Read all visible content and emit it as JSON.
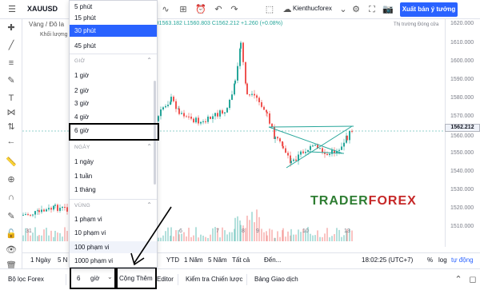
{
  "topbar": {
    "symbol": "XAUUSD",
    "layout_name": "Kienthucforex",
    "publish_label": "Xuất bản ý tưởng"
  },
  "chart": {
    "subtitle": "Vàng / Đô la",
    "volume_label": "Khối lượng",
    "ohlc": "852  H1563.182  L1560.803  C1562.212  +1.260 (+0.08%)",
    "market_closed": "Thị trường Đóng cửa",
    "last_price": "1562.212",
    "price_labels": [
      "1620.000",
      "1610.000",
      "1600.000",
      "1590.000",
      "1580.000",
      "1570.000",
      "1560.000",
      "1550.000",
      "1540.000",
      "1530.000",
      "1520.000",
      "1510.000"
    ],
    "time_labels": [
      "31",
      "6",
      "7",
      "8",
      "9",
      "10",
      "13"
    ],
    "watermark_a": "TRADER",
    "watermark_b": "FOREX"
  },
  "rangebar": {
    "items": [
      "1 Ngày",
      "5 N",
      "YTD",
      "1 Năm",
      "5 Năm",
      "Tất cả",
      "Đến..."
    ],
    "clock": "18:02:25 (UTC+7)",
    "pct": "%",
    "log": "log",
    "auto": "tự động"
  },
  "bottombar": {
    "screener": "Bộ lọc Forex",
    "qty": "6",
    "unit": "giờ",
    "add_label": "Cộng Thêm",
    "editor": "Editor",
    "strategy": "Kiểm tra Chiến lược",
    "trading": "Bảng Giao dịch"
  },
  "dropdown": {
    "items_top": [
      "5 phút",
      "15 phút",
      "30 phút",
      "45 phút"
    ],
    "selected": "30 phút",
    "group_hour": "GIỜ",
    "items_hour": [
      "1 giờ",
      "2 giờ",
      "3 giờ",
      "4 giờ",
      "6 giờ"
    ],
    "group_day": "NGÀY",
    "items_day": [
      "1 ngày",
      "1 tuần",
      "1 tháng"
    ],
    "group_range": "VÙNG",
    "items_range": [
      "1 phạm vi",
      "10 phạm vi",
      "100 phạm vi",
      "1000 phạm vi"
    ]
  },
  "colors": {
    "accent": "#2962ff",
    "up": "#26a69a",
    "down": "#ef5350",
    "trendline": "#26a69a",
    "watermark_a": "#2e7d32",
    "watermark_b": "#c62828"
  }
}
